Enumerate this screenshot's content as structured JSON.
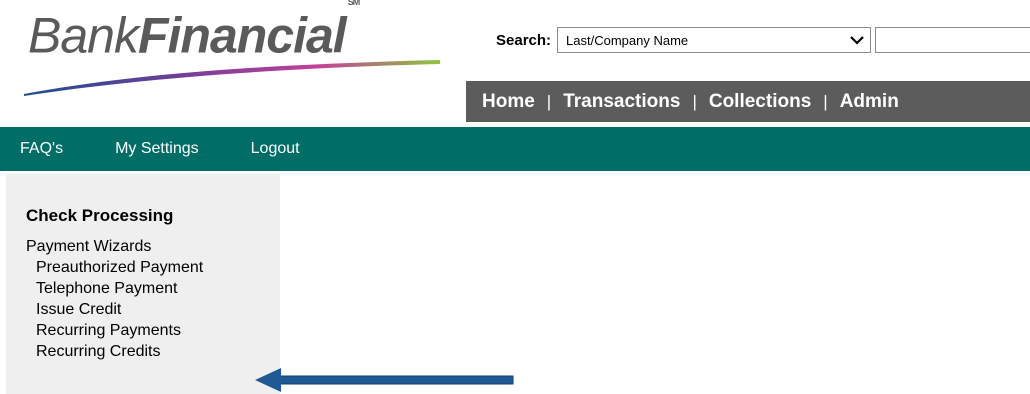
{
  "logo": {
    "word1": "Bank",
    "word2": "Financial",
    "mark": "SM"
  },
  "search": {
    "label": "Search:",
    "selected": "Last/Company Name",
    "chevron": "chevron-down-icon"
  },
  "topnav": [
    "Home",
    "Transactions",
    "Collections",
    "Admin"
  ],
  "topnav_sep": "|",
  "greenbar": [
    "FAQ's",
    "My Settings",
    "Logout"
  ],
  "sidebar": {
    "heading": "Check Processing",
    "group": "Payment Wizards",
    "items": [
      "Preauthorized Payment",
      "Telephone Payment",
      "Issue Credit",
      "Recurring Payments",
      "Recurring Credits"
    ]
  },
  "colors": {
    "nav_gray": "#5c5c5c",
    "green": "#006e66",
    "arrow": "#1f5a96",
    "sidebar_bg": "#efefef"
  }
}
